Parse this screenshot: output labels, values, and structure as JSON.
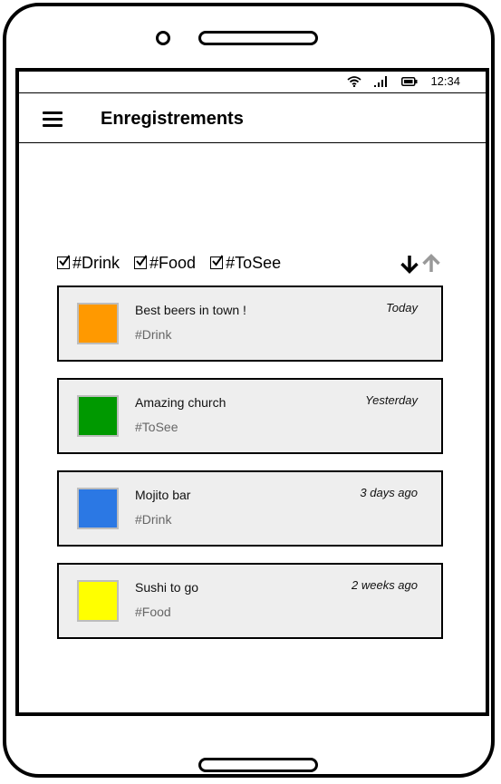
{
  "status_bar": {
    "time": "12:34",
    "icons": [
      "wifi-icon",
      "signal-icon",
      "battery-icon"
    ]
  },
  "header": {
    "title": "Enregistrements",
    "menu_icon": "hamburger-menu-icon"
  },
  "filters": [
    {
      "label": "#Drink",
      "checked": true
    },
    {
      "label": "#Food",
      "checked": true
    },
    {
      "label": "#ToSee",
      "checked": true
    }
  ],
  "sort": {
    "descending_icon": "arrow-down-icon",
    "ascending_icon": "arrow-up-icon",
    "active": "descending"
  },
  "items": [
    {
      "title": "Best beers in town !",
      "tag": "#Drink",
      "time": "Today",
      "color": "#ff9900"
    },
    {
      "title": "Amazing church",
      "tag": "#ToSee",
      "time": "Yesterday",
      "color": "#009900"
    },
    {
      "title": "Mojito bar",
      "tag": "#Drink",
      "time": "3 days ago",
      "color": "#2b78e4"
    },
    {
      "title": "Sushi to go",
      "tag": "#Food",
      "time": "2 weeks ago",
      "color": "#ffff00"
    }
  ],
  "colors": {
    "card_background": "#eeeeee",
    "tag_text": "#666666",
    "sort_inactive": "#999999"
  }
}
